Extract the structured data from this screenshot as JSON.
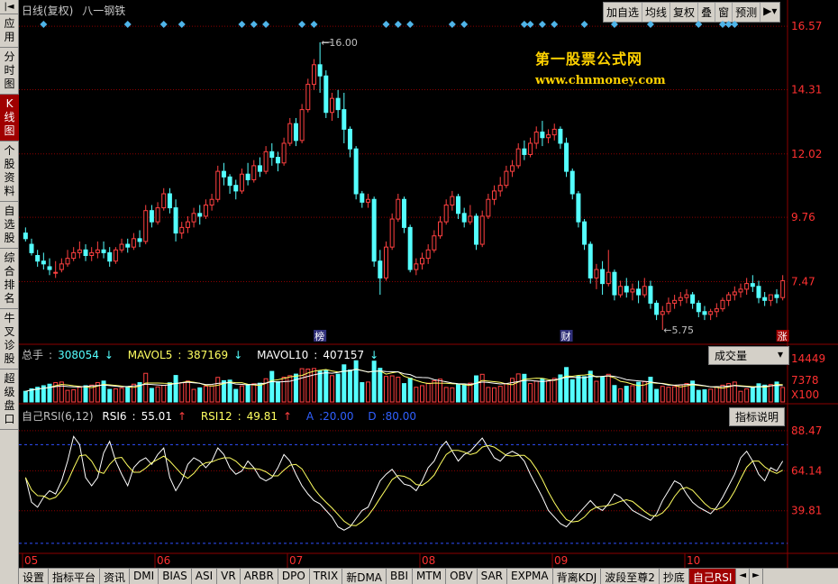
{
  "sidebar": {
    "top_icon": "left-arrow-bar-icon",
    "items": [
      {
        "label": "应用",
        "active": false
      },
      {
        "label": "分时图",
        "active": false
      },
      {
        "label": "K线图",
        "active": true
      },
      {
        "label": "个股资料",
        "active": false
      },
      {
        "label": "自选股",
        "active": false
      },
      {
        "label": "综合排名",
        "active": false
      },
      {
        "label": "牛叉诊股",
        "active": false
      },
      {
        "label": "超级盘口",
        "active": false
      }
    ]
  },
  "header": {
    "title": "日线(复权)",
    "stock_name": "八一钢铁",
    "toolbar": [
      "加自选",
      "均线",
      "复权",
      "叠",
      "窗",
      "预测"
    ],
    "toolbar_icon": "play-menu-icon"
  },
  "watermark": {
    "title": "第一股票公式网",
    "url": "www.chnmoney.com"
  },
  "colors": {
    "up": "#ff4040",
    "down": "#54ffff",
    "price_axis": "#ff3030",
    "ma5": "#ffff60",
    "ma10": "#ffffff",
    "grid": "#8b0000",
    "marker": "#4fb4e8",
    "dashed": "#3050ff"
  },
  "chart_data": {
    "type": "candlestick",
    "price_ticks": [
      "16.57",
      "14.31",
      "12.02",
      "9.76",
      "7.47"
    ],
    "annotations": {
      "high": "16.00",
      "low": "5.75"
    },
    "event_labels": [
      "榜",
      "财",
      "涨"
    ],
    "x_labels": [
      "05",
      "06",
      "07",
      "08",
      "09",
      "10"
    ],
    "candles": [
      [
        9.2,
        9.4,
        9.0,
        8.9
      ],
      [
        8.8,
        9.0,
        8.5,
        8.4
      ],
      [
        8.4,
        8.6,
        8.2,
        8.0
      ],
      [
        8.2,
        8.5,
        8.1,
        7.9
      ],
      [
        8.0,
        8.3,
        7.9,
        7.7
      ],
      [
        7.8,
        8.2,
        7.8,
        7.6
      ],
      [
        7.9,
        8.3,
        8.1,
        7.8
      ],
      [
        8.1,
        8.6,
        8.3,
        8.0
      ],
      [
        8.3,
        8.7,
        8.5,
        8.2
      ],
      [
        8.5,
        8.9,
        8.6,
        8.3
      ],
      [
        8.6,
        8.8,
        8.4,
        8.2
      ],
      [
        8.4,
        8.7,
        8.5,
        8.2
      ],
      [
        8.5,
        8.9,
        8.6,
        8.3
      ],
      [
        8.6,
        8.9,
        8.5,
        8.3
      ],
      [
        8.5,
        8.7,
        8.2,
        8.0
      ],
      [
        8.2,
        8.7,
        8.6,
        8.1
      ],
      [
        8.6,
        9.0,
        8.8,
        8.5
      ],
      [
        8.8,
        9.0,
        8.7,
        8.5
      ],
      [
        8.7,
        9.2,
        9.0,
        8.6
      ],
      [
        9.0,
        9.3,
        8.9,
        8.7
      ],
      [
        8.9,
        10.2,
        10.0,
        8.8
      ],
      [
        10.0,
        10.2,
        9.6,
        9.4
      ],
      [
        9.6,
        10.3,
        10.1,
        9.5
      ],
      [
        10.1,
        10.8,
        10.6,
        10.0
      ],
      [
        10.6,
        10.8,
        10.1,
        9.9
      ],
      [
        10.1,
        10.4,
        9.2,
        8.9
      ],
      [
        9.2,
        9.6,
        9.4,
        9.0
      ],
      [
        9.4,
        9.8,
        9.6,
        9.2
      ],
      [
        9.6,
        10.1,
        9.9,
        9.4
      ],
      [
        9.9,
        10.2,
        9.8,
        9.5
      ],
      [
        9.8,
        10.4,
        10.2,
        9.7
      ],
      [
        10.2,
        10.6,
        10.4,
        10.0
      ],
      [
        10.4,
        11.6,
        11.4,
        10.3
      ],
      [
        11.4,
        11.7,
        11.2,
        10.9
      ],
      [
        11.2,
        11.3,
        10.9,
        10.6
      ],
      [
        10.9,
        11.1,
        10.7,
        10.4
      ],
      [
        10.7,
        11.5,
        11.3,
        10.6
      ],
      [
        11.3,
        11.7,
        11.1,
        10.9
      ],
      [
        11.1,
        11.8,
        11.6,
        11.0
      ],
      [
        11.6,
        11.9,
        11.4,
        11.2
      ],
      [
        11.4,
        12.3,
        12.1,
        11.3
      ],
      [
        12.1,
        12.4,
        11.9,
        11.6
      ],
      [
        11.9,
        12.1,
        11.7,
        11.4
      ],
      [
        11.7,
        12.6,
        12.4,
        11.6
      ],
      [
        12.4,
        13.3,
        13.1,
        12.3
      ],
      [
        13.1,
        13.3,
        12.5,
        12.3
      ],
      [
        12.5,
        13.8,
        13.6,
        12.4
      ],
      [
        13.6,
        14.7,
        14.5,
        13.5
      ],
      [
        14.5,
        15.4,
        15.2,
        14.3
      ],
      [
        15.2,
        16.0,
        14.8,
        14.2
      ],
      [
        14.8,
        15.0,
        13.5,
        13.3
      ],
      [
        13.5,
        14.2,
        14.0,
        13.2
      ],
      [
        14.0,
        14.3,
        13.6,
        13.3
      ],
      [
        13.6,
        14.2,
        12.9,
        12.4
      ],
      [
        12.9,
        13.0,
        12.2,
        11.9
      ],
      [
        12.2,
        12.3,
        10.6,
        10.4
      ],
      [
        10.6,
        10.7,
        10.3,
        10.1
      ],
      [
        10.3,
        10.6,
        10.4,
        10.1
      ],
      [
        10.4,
        10.5,
        8.2,
        8.0
      ],
      [
        8.2,
        8.6,
        7.6,
        7.0
      ],
      [
        7.6,
        8.9,
        8.7,
        7.5
      ],
      [
        8.7,
        9.9,
        9.7,
        8.6
      ],
      [
        9.7,
        10.6,
        10.4,
        9.6
      ],
      [
        10.4,
        10.5,
        9.4,
        9.2
      ],
      [
        9.4,
        9.5,
        7.9,
        7.8
      ],
      [
        7.9,
        8.3,
        8.1,
        7.7
      ],
      [
        8.1,
        8.5,
        8.3,
        7.9
      ],
      [
        8.3,
        8.8,
        8.6,
        8.1
      ],
      [
        8.6,
        9.3,
        9.1,
        8.5
      ],
      [
        9.1,
        9.8,
        9.6,
        9.0
      ],
      [
        9.6,
        10.4,
        10.2,
        9.5
      ],
      [
        10.2,
        10.7,
        10.5,
        10.0
      ],
      [
        10.5,
        10.6,
        9.9,
        9.7
      ],
      [
        9.9,
        10.1,
        9.6,
        9.4
      ],
      [
        9.6,
        10.2,
        9.8,
        9.5
      ],
      [
        9.8,
        9.9,
        8.8,
        8.6
      ],
      [
        8.8,
        10.0,
        9.8,
        8.7
      ],
      [
        9.8,
        10.6,
        10.4,
        9.7
      ],
      [
        10.4,
        10.9,
        10.7,
        10.2
      ],
      [
        10.7,
        11.2,
        10.9,
        10.5
      ],
      [
        10.9,
        11.6,
        11.4,
        10.8
      ],
      [
        11.4,
        11.8,
        11.6,
        11.2
      ],
      [
        11.6,
        12.4,
        12.2,
        11.5
      ],
      [
        12.2,
        12.5,
        12.0,
        11.8
      ],
      [
        12.0,
        12.6,
        12.4,
        11.9
      ],
      [
        12.4,
        13.0,
        12.8,
        12.2
      ],
      [
        12.8,
        13.2,
        12.6,
        12.3
      ],
      [
        12.6,
        12.9,
        12.7,
        12.4
      ],
      [
        12.7,
        13.1,
        12.9,
        12.5
      ],
      [
        12.9,
        13.0,
        12.4,
        12.2
      ],
      [
        12.4,
        12.6,
        11.4,
        11.2
      ],
      [
        11.4,
        11.5,
        10.6,
        10.4
      ],
      [
        10.6,
        10.7,
        9.6,
        9.4
      ],
      [
        9.6,
        9.7,
        8.8,
        8.6
      ],
      [
        8.8,
        8.9,
        7.6,
        7.4
      ],
      [
        7.6,
        8.1,
        7.9,
        7.2
      ],
      [
        7.9,
        8.2,
        7.4,
        7.0
      ],
      [
        7.4,
        8.6,
        7.8,
        7.3
      ],
      [
        7.8,
        7.9,
        7.0,
        6.8
      ],
      [
        7.0,
        7.5,
        7.3,
        6.9
      ],
      [
        7.3,
        7.6,
        7.1,
        6.9
      ],
      [
        7.1,
        7.4,
        7.2,
        6.8
      ],
      [
        7.2,
        7.5,
        7.0,
        6.7
      ],
      [
        7.0,
        7.6,
        7.3,
        6.9
      ],
      [
        7.3,
        7.5,
        6.7,
        6.5
      ],
      [
        6.7,
        6.8,
        6.3,
        6.1
      ],
      [
        6.3,
        6.6,
        6.4,
        5.75
      ],
      [
        6.4,
        6.9,
        6.7,
        6.3
      ],
      [
        6.7,
        7.0,
        6.8,
        6.5
      ],
      [
        6.8,
        7.1,
        6.9,
        6.6
      ],
      [
        6.9,
        7.2,
        7.0,
        6.7
      ],
      [
        7.0,
        7.1,
        6.7,
        6.5
      ],
      [
        6.7,
        6.8,
        6.4,
        6.2
      ],
      [
        6.4,
        6.6,
        6.3,
        6.1
      ],
      [
        6.3,
        6.5,
        6.4,
        6.1
      ],
      [
        6.4,
        6.7,
        6.5,
        6.2
      ],
      [
        6.5,
        6.9,
        6.8,
        6.4
      ],
      [
        6.8,
        7.1,
        7.0,
        6.6
      ],
      [
        7.0,
        7.3,
        7.1,
        6.8
      ],
      [
        7.1,
        7.4,
        7.2,
        6.9
      ],
      [
        7.2,
        7.6,
        7.4,
        7.0
      ],
      [
        7.4,
        7.7,
        7.3,
        7.1
      ],
      [
        7.3,
        7.5,
        6.9,
        6.7
      ],
      [
        6.9,
        7.1,
        6.8,
        6.6
      ],
      [
        6.8,
        7.0,
        7.0,
        6.6
      ],
      [
        7.0,
        7.2,
        6.9,
        6.7
      ],
      [
        6.9,
        7.7,
        7.5,
        6.8
      ]
    ],
    "volume": {
      "label": "总手",
      "total": "308054",
      "ma5_label": "MAVOL5",
      "ma5": "387169",
      "ma10_label": "MAVOL10",
      "ma10": "407157",
      "ticks": [
        "14449",
        "7378",
        "X100"
      ],
      "panel_button": "成交量"
    },
    "rsi": {
      "name": "自己RSI(6,12)",
      "rsi6_label": "RSI6",
      "rsi6": "55.01",
      "rsi12_label": "RSI12",
      "rsi12": "49.81",
      "a_label": "A",
      "a": "20.00",
      "d_label": "D",
      "d": "80.00",
      "ticks": [
        "88.47",
        "64.14",
        "39.81"
      ],
      "panel_button": "指标说明",
      "rsi6_values": [
        60,
        45,
        42,
        48,
        52,
        50,
        58,
        70,
        85,
        80,
        60,
        55,
        60,
        75,
        82,
        70,
        62,
        55,
        66,
        70,
        72,
        68,
        74,
        78,
        60,
        52,
        58,
        68,
        72,
        70,
        66,
        70,
        78,
        74,
        66,
        62,
        64,
        70,
        66,
        60,
        58,
        60,
        66,
        74,
        70,
        62,
        55,
        50,
        46,
        44,
        40,
        36,
        30,
        28,
        30,
        35,
        40,
        42,
        50,
        58,
        62,
        65,
        60,
        56,
        55,
        52,
        58,
        66,
        70,
        78,
        82,
        76,
        70,
        74,
        76,
        80,
        84,
        78,
        72,
        70,
        74,
        76,
        74,
        70,
        62,
        55,
        48,
        40,
        36,
        32,
        30,
        34,
        38,
        42,
        46,
        42,
        40,
        44,
        50,
        48,
        44,
        40,
        38,
        36,
        34,
        38,
        46,
        52,
        58,
        56,
        50,
        45,
        42,
        40,
        38,
        42,
        48,
        55,
        62,
        72,
        76,
        70,
        62,
        58,
        66,
        64,
        70
      ]
    },
    "event_markers": [
      3,
      17,
      23,
      26,
      36,
      38,
      40,
      46,
      48,
      60,
      62,
      64,
      71,
      73,
      83,
      84,
      86,
      88,
      93,
      98,
      104,
      112,
      116,
      117,
      118
    ]
  },
  "tabs": {
    "items": [
      "设置",
      "指标平台",
      "资讯",
      "DMI",
      "BIAS",
      "ASI",
      "VR",
      "ARBR",
      "DPO",
      "TRIX",
      "新DMA",
      "BBI",
      "MTM",
      "OBV",
      "SAR",
      "EXPMA",
      "背离KDJ",
      "波段至尊2",
      "抄底",
      "自己RSI"
    ],
    "active_index": 19,
    "nav": [
      "◄",
      "►"
    ]
  }
}
